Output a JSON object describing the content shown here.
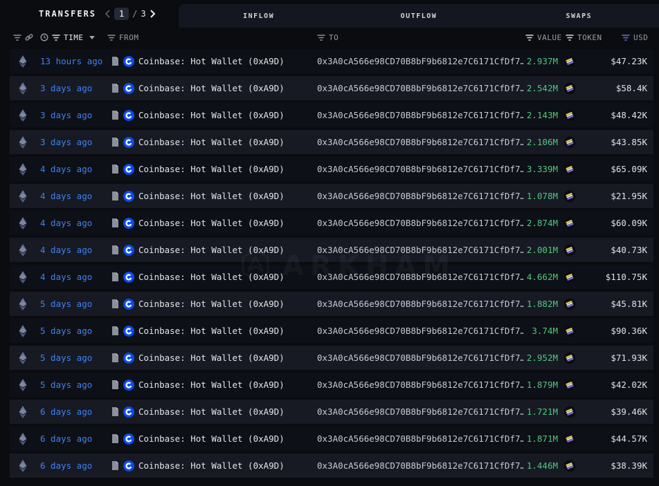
{
  "topbar": {
    "transfers_label": "TRANSFERS",
    "pagination": {
      "current_page": "1",
      "separator": "/",
      "total_pages": "3"
    },
    "tabs": [
      {
        "label": "INFLOW"
      },
      {
        "label": "OUTFLOW"
      },
      {
        "label": "SWAPS"
      }
    ]
  },
  "table": {
    "headers": {
      "time": "TIME",
      "from": "FROM",
      "to": "TO",
      "value": "VALUE",
      "token": "TOKEN",
      "usd": "USD"
    },
    "rows": [
      {
        "time": "13 hours ago",
        "from": "Coinbase: Hot Wallet (0xA9D)",
        "to": "0x3A0cA566e98CD70B8bF9b6812e7C6171CfDf7…",
        "value": "2.937M",
        "usd": "$47.23K"
      },
      {
        "time": "3 days ago",
        "from": "Coinbase: Hot Wallet (0xA9D)",
        "to": "0x3A0cA566e98CD70B8bF9b6812e7C6171CfDf7…",
        "value": "2.542M",
        "usd": "$58.4K"
      },
      {
        "time": "3 days ago",
        "from": "Coinbase: Hot Wallet (0xA9D)",
        "to": "0x3A0cA566e98CD70B8bF9b6812e7C6171CfDf7…",
        "value": "2.143M",
        "usd": "$48.42K"
      },
      {
        "time": "3 days ago",
        "from": "Coinbase: Hot Wallet (0xA9D)",
        "to": "0x3A0cA566e98CD70B8bF9b6812e7C6171CfDf7…",
        "value": "2.106M",
        "usd": "$43.85K"
      },
      {
        "time": "4 days ago",
        "from": "Coinbase: Hot Wallet (0xA9D)",
        "to": "0x3A0cA566e98CD70B8bF9b6812e7C6171CfDf7…",
        "value": "3.339M",
        "usd": "$65.09K"
      },
      {
        "time": "4 days ago",
        "from": "Coinbase: Hot Wallet (0xA9D)",
        "to": "0x3A0cA566e98CD70B8bF9b6812e7C6171CfDf7…",
        "value": "1.078M",
        "usd": "$21.95K"
      },
      {
        "time": "4 days ago",
        "from": "Coinbase: Hot Wallet (0xA9D)",
        "to": "0x3A0cA566e98CD70B8bF9b6812e7C6171CfDf7…",
        "value": "2.874M",
        "usd": "$60.09K"
      },
      {
        "time": "4 days ago",
        "from": "Coinbase: Hot Wallet (0xA9D)",
        "to": "0x3A0cA566e98CD70B8bF9b6812e7C6171CfDf7…",
        "value": "2.001M",
        "usd": "$40.73K"
      },
      {
        "time": "4 days ago",
        "from": "Coinbase: Hot Wallet (0xA9D)",
        "to": "0x3A0cA566e98CD70B8bF9b6812e7C6171CfDf7…",
        "value": "4.662M",
        "usd": "$110.75K"
      },
      {
        "time": "5 days ago",
        "from": "Coinbase: Hot Wallet (0xA9D)",
        "to": "0x3A0cA566e98CD70B8bF9b6812e7C6171CfDf7…",
        "value": "1.882M",
        "usd": "$45.81K"
      },
      {
        "time": "5 days ago",
        "from": "Coinbase: Hot Wallet (0xA9D)",
        "to": "0x3A0cA566e98CD70B8bF9b6812e7C6171CfDf7…",
        "value": "3.74M",
        "usd": "$90.36K"
      },
      {
        "time": "5 days ago",
        "from": "Coinbase: Hot Wallet (0xA9D)",
        "to": "0x3A0cA566e98CD70B8bF9b6812e7C6171CfDf7…",
        "value": "2.952M",
        "usd": "$71.93K"
      },
      {
        "time": "5 days ago",
        "from": "Coinbase: Hot Wallet (0xA9D)",
        "to": "0x3A0cA566e98CD70B8bF9b6812e7C6171CfDf7…",
        "value": "1.879M",
        "usd": "$42.02K"
      },
      {
        "time": "6 days ago",
        "from": "Coinbase: Hot Wallet (0xA9D)",
        "to": "0x3A0cA566e98CD70B8bF9b6812e7C6171CfDf7…",
        "value": "1.721M",
        "usd": "$39.46K"
      },
      {
        "time": "6 days ago",
        "from": "Coinbase: Hot Wallet (0xA9D)",
        "to": "0x3A0cA566e98CD70B8bF9b6812e7C6171CfDf7…",
        "value": "1.871M",
        "usd": "$44.57K"
      },
      {
        "time": "6 days ago",
        "from": "Coinbase: Hot Wallet (0xA9D)",
        "to": "0x3A0cA566e98CD70B8bF9b6812e7C6171CfDf7…",
        "value": "1.446M",
        "usd": "$38.39K"
      }
    ]
  },
  "watermark": {
    "text": "ARKHAM"
  },
  "icons": {
    "chain": "ethereum-icon",
    "document": "transaction-document-icon",
    "entity": "coinbase-icon",
    "token": "token-icon",
    "filter": "filter-funnel-icon",
    "link": "link-icon",
    "clock": "clock-icon"
  },
  "colors": {
    "page-bg": "#0a0c10",
    "tabbar-bg": "#14171f",
    "row-dark": "#0d1016",
    "row-light": "#171a23",
    "link-blue": "#3d82f5",
    "value-green": "#52c77e",
    "coinbase-blue": "#0a4cf0",
    "filter-purple": "#6b6ef2",
    "text-secondary": "#969ca6",
    "address-grey": "#c7cbd2"
  }
}
